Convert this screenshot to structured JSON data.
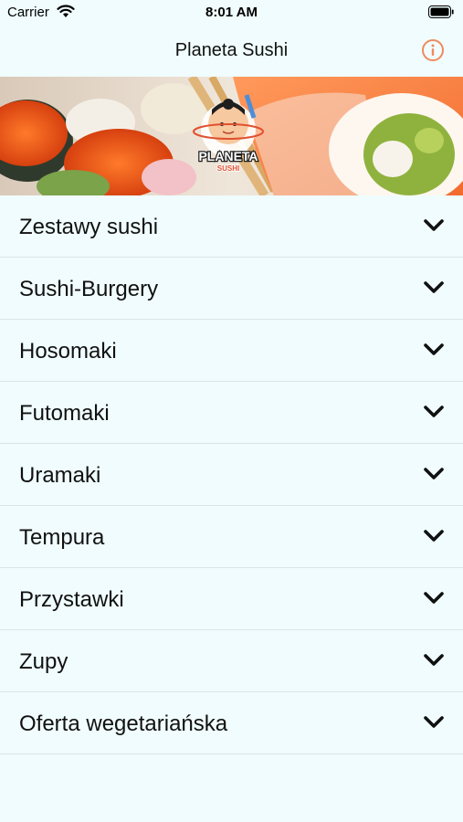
{
  "status": {
    "carrier": "Carrier",
    "time": "8:01 AM",
    "wifi_icon": "wifi-icon",
    "battery_icon": "battery-icon"
  },
  "nav": {
    "title": "Planeta Sushi",
    "info_icon": "info-icon",
    "accent": "#f08a5d"
  },
  "banner": {
    "logo_top": "PLANETA",
    "logo_bottom": "SUSHI"
  },
  "categories": [
    {
      "label": "Zestawy sushi"
    },
    {
      "label": "Sushi-Burgery"
    },
    {
      "label": "Hosomaki"
    },
    {
      "label": "Futomaki"
    },
    {
      "label": "Uramaki"
    },
    {
      "label": "Tempura"
    },
    {
      "label": "Przystawki"
    },
    {
      "label": "Zupy"
    },
    {
      "label": "Oferta wegetariańska"
    }
  ],
  "chevron_icon": "chevron-down-icon"
}
